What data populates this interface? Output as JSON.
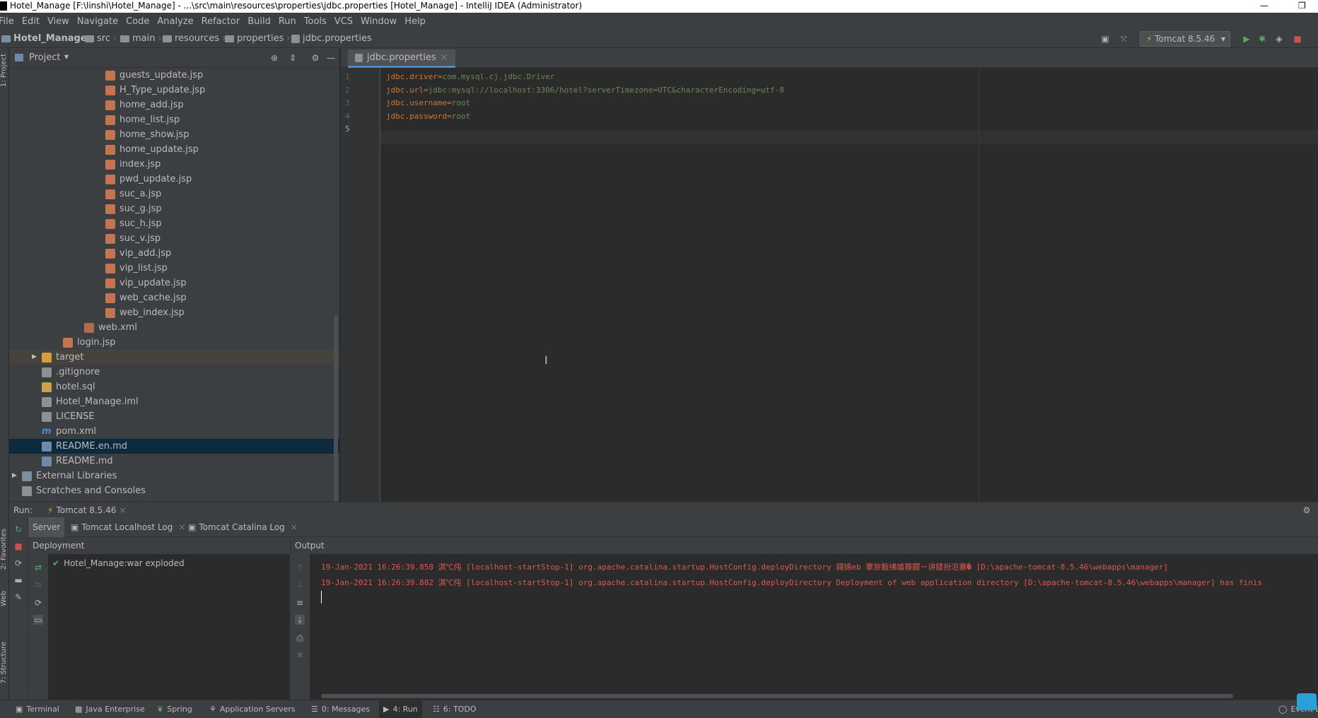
{
  "window": {
    "title": "Hotel_Manage [F:\\linshi\\Hotel_Manage] - ...\\src\\main\\resources\\properties\\jdbc.properties [Hotel_Manage] - IntelliJ IDEA (Administrator)"
  },
  "menu": [
    "File",
    "Edit",
    "View",
    "Navigate",
    "Code",
    "Analyze",
    "Refactor",
    "Build",
    "Run",
    "Tools",
    "VCS",
    "Window",
    "Help"
  ],
  "breadcrumb": {
    "project": "Hotel_Manage",
    "items": [
      "src",
      "main",
      "resources",
      "properties",
      "jdbc.properties"
    ]
  },
  "run_config": "Tomcat 8.5.46",
  "project_panel": {
    "title": "Project",
    "tree": [
      {
        "name": "guests_update.jsp",
        "type": "jsp",
        "indent": 3
      },
      {
        "name": "H_Type_update.jsp",
        "type": "jsp",
        "indent": 3
      },
      {
        "name": "home_add.jsp",
        "type": "jsp",
        "indent": 3
      },
      {
        "name": "home_list.jsp",
        "type": "jsp",
        "indent": 3
      },
      {
        "name": "home_show.jsp",
        "type": "jsp",
        "indent": 3
      },
      {
        "name": "home_update.jsp",
        "type": "jsp",
        "indent": 3
      },
      {
        "name": "index.jsp",
        "type": "jsp",
        "indent": 3
      },
      {
        "name": "pwd_update.jsp",
        "type": "jsp",
        "indent": 3
      },
      {
        "name": "suc_a.jsp",
        "type": "jsp",
        "indent": 3
      },
      {
        "name": "suc_g.jsp",
        "type": "jsp",
        "indent": 3
      },
      {
        "name": "suc_h.jsp",
        "type": "jsp",
        "indent": 3
      },
      {
        "name": "suc_v.jsp",
        "type": "jsp",
        "indent": 3
      },
      {
        "name": "vip_add.jsp",
        "type": "jsp",
        "indent": 3
      },
      {
        "name": "vip_list.jsp",
        "type": "jsp",
        "indent": 3
      },
      {
        "name": "vip_update.jsp",
        "type": "jsp",
        "indent": 3
      },
      {
        "name": "web_cache.jsp",
        "type": "jsp",
        "indent": 3
      },
      {
        "name": "web_index.jsp",
        "type": "jsp",
        "indent": 3
      },
      {
        "name": "web.xml",
        "type": "xml",
        "indent": 2
      },
      {
        "name": "login.jsp",
        "type": "jsp",
        "indent": 1
      },
      {
        "name": "target",
        "type": "folder",
        "indent": 0
      },
      {
        "name": ".gitignore",
        "type": "txt",
        "indent": 0
      },
      {
        "name": "hotel.sql",
        "type": "sql",
        "indent": 0
      },
      {
        "name": "Hotel_Manage.iml",
        "type": "txt",
        "indent": 0
      },
      {
        "name": "LICENSE",
        "type": "txt",
        "indent": 0
      },
      {
        "name": "pom.xml",
        "type": "pom",
        "indent": 0
      },
      {
        "name": "README.en.md",
        "type": "md",
        "indent": 0,
        "selected": true
      },
      {
        "name": "README.md",
        "type": "md",
        "indent": 0
      },
      {
        "name": "External Libraries",
        "type": "lib",
        "indent": -1
      },
      {
        "name": "Scratches and Consoles",
        "type": "scratch",
        "indent": -1
      }
    ]
  },
  "editor": {
    "tab": "jdbc.properties",
    "line_numbers": [
      "1",
      "2",
      "3",
      "4",
      "5"
    ],
    "lines": [
      {
        "key": "jdbc.driver",
        "value": "com.mysql.cj.jdbc.Driver"
      },
      {
        "key": "jdbc.url",
        "value": "jdbc:mysql://localhost:3306/hotel?serverTimezone=UTC&characterEncoding=utf-8"
      },
      {
        "key": "jdbc.username",
        "value": "root"
      },
      {
        "key": "jdbc.password",
        "value": "root"
      }
    ]
  },
  "run_panel": {
    "label": "Run:",
    "config_tab": "Tomcat 8.5.46",
    "tabs": [
      "Server",
      "Tomcat Localhost Log",
      "Tomcat Catalina Log"
    ],
    "deployment_header": "Deployment",
    "output_header": "Output",
    "deployment_item": "Hotel_Manage:war exploded",
    "log_lines": [
      "19-Jan-2021 16:26:39.858 淇℃伅 [localhost-startStop-1] org.apache.catalina.startup.HostConfig.deployDirectory 鎶婂eb 搴旂敤绋嬪簭閮ㄧ讲鍒扮洰褰� [D:\\apache-tomcat-8.5.46\\webapps\\manager]",
      "19-Jan-2021 16:26:39.882 淇℃伅 [localhost-startStop-1] org.apache.catalina.startup.HostConfig.deployDirectory Deployment of web application directory [D:\\apache-tomcat-8.5.46\\webapps\\manager] has finis"
    ]
  },
  "left_strip": {
    "project": "1: Project",
    "favorites": "2: Favorites",
    "web": "Web",
    "structure": "7: Structure"
  },
  "status_tabs": [
    "Terminal",
    "Java Enterprise",
    "Spring",
    "Application Servers",
    "0: Messages",
    "4: Run",
    "6: TODO"
  ],
  "event_log": "Event L"
}
